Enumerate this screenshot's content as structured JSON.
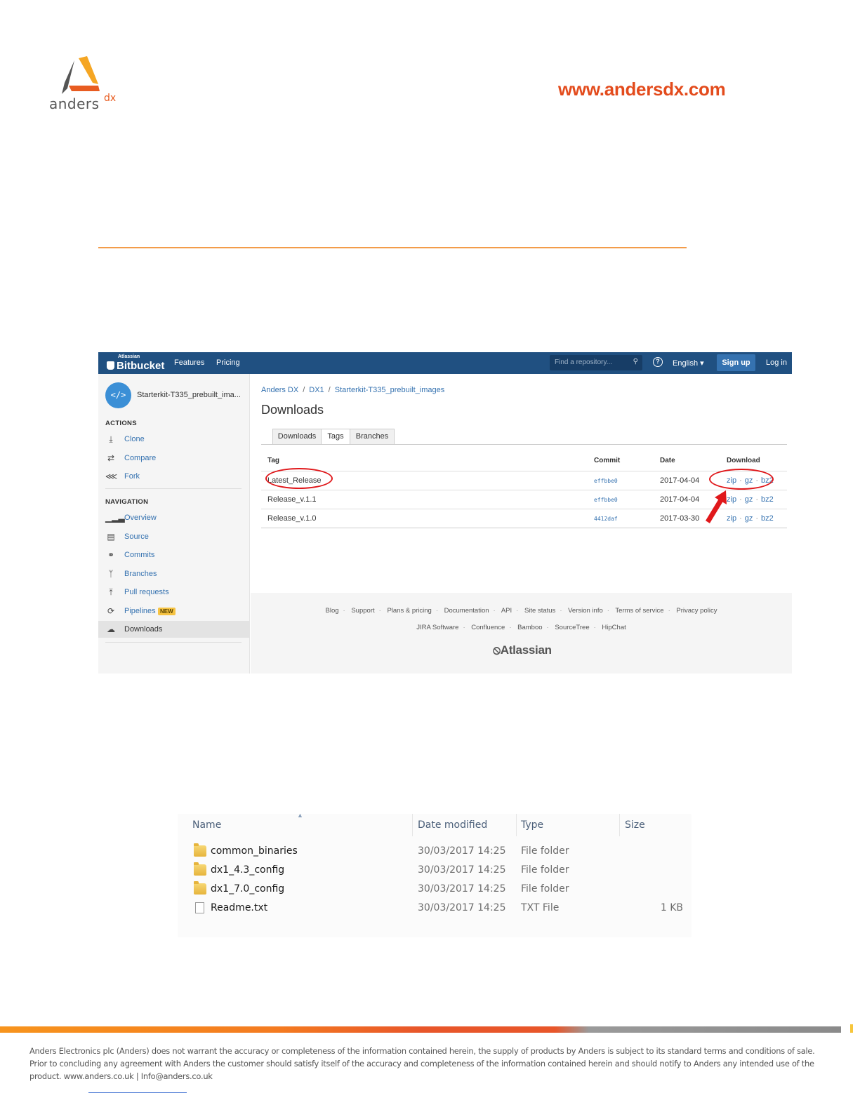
{
  "header": {
    "logo_text": "anders",
    "logo_sup": "dx",
    "website": "www.andersdx.com"
  },
  "bitbucket": {
    "brand_small": "Atlassian",
    "brand_name": "Bitbucket",
    "nav": [
      "Features",
      "Pricing"
    ],
    "search_placeholder": "Find a repository...",
    "language": "English ▾",
    "signup": "Sign up",
    "login": "Log in",
    "repo_name": "Starterkit-T335_prebuilt_ima...",
    "actions_heading": "ACTIONS",
    "actions": [
      {
        "label": "Clone",
        "icon": "download-icon"
      },
      {
        "label": "Compare",
        "icon": "shuffle-icon"
      },
      {
        "label": "Fork",
        "icon": "fork-icon"
      }
    ],
    "navigation_heading": "NAVIGATION",
    "navigation": [
      {
        "label": "Overview",
        "icon": "bars-icon"
      },
      {
        "label": "Source",
        "icon": "file-icon"
      },
      {
        "label": "Commits",
        "icon": "commit-icon"
      },
      {
        "label": "Branches",
        "icon": "branch-icon"
      },
      {
        "label": "Pull requests",
        "icon": "upload-icon"
      },
      {
        "label": "Pipelines",
        "icon": "refresh-icon",
        "badge": "NEW"
      },
      {
        "label": "Downloads",
        "icon": "cloud-icon",
        "active": true
      }
    ],
    "breadcrumb": [
      "Anders DX",
      "DX1",
      "Starterkit-T335_prebuilt_images"
    ],
    "page_title": "Downloads",
    "tabs": [
      "Downloads",
      "Tags",
      "Branches"
    ],
    "active_tab": "Tags",
    "table_headers": [
      "Tag",
      "Commit",
      "Date",
      "Download"
    ],
    "rows": [
      {
        "tag": "Latest_Release",
        "commit": "effbbe0",
        "date": "2017-04-04",
        "links": [
          "zip",
          "gz",
          "bz2"
        ]
      },
      {
        "tag": "Release_v.1.1",
        "commit": "effbbe0",
        "date": "2017-04-04",
        "links": [
          "zip",
          "gz",
          "bz2"
        ]
      },
      {
        "tag": "Release_v.1.0",
        "commit": "4412daf",
        "date": "2017-03-30",
        "links": [
          "zip",
          "gz",
          "bz2"
        ]
      }
    ],
    "footer_links_1": [
      "Blog",
      "Support",
      "Plans & pricing",
      "Documentation",
      "API",
      "Site status",
      "Version info",
      "Terms of service",
      "Privacy policy"
    ],
    "footer_links_2": [
      "JIRA Software",
      "Confluence",
      "Bamboo",
      "SourceTree",
      "HipChat"
    ],
    "footer_brand": "Atlassian",
    "annotation_color": "#e0181b"
  },
  "explorer": {
    "columns": [
      "Name",
      "Date modified",
      "Type",
      "Size"
    ],
    "files": [
      {
        "name": "common_binaries",
        "date": "30/03/2017 14:25",
        "type": "File folder",
        "size": "",
        "icon": "folder-icon"
      },
      {
        "name": "dx1_4.3_config",
        "date": "30/03/2017 14:25",
        "type": "File folder",
        "size": "",
        "icon": "folder-icon"
      },
      {
        "name": "dx1_7.0_config",
        "date": "30/03/2017 14:25",
        "type": "File folder",
        "size": "",
        "icon": "folder-icon"
      },
      {
        "name": "Readme.txt",
        "date": "30/03/2017 14:25",
        "type": "TXT File",
        "size": "1 KB",
        "icon": "text-file-icon"
      }
    ]
  },
  "footer": {
    "disclaimer": "Anders Electronics plc (Anders) does not warrant the accuracy or completeness of the information contained herein, the supply of products by Anders is subject to its standard terms and conditions of sale. Prior to concluding any agreement with Anders the customer should satisfy itself of the accuracy and completeness of the information contained herein and should notify to Anders any intended use of the product. www.anders.co.uk | Info@anders.co.uk"
  }
}
